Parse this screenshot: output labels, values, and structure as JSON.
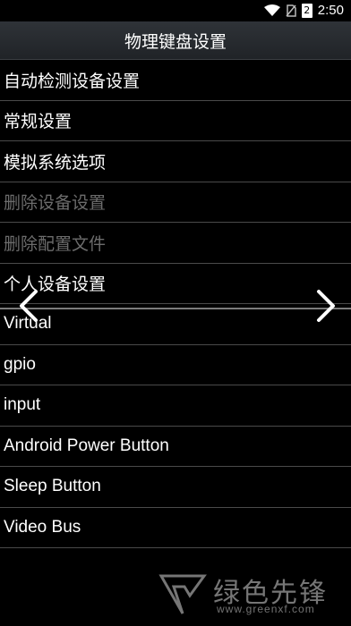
{
  "status": {
    "time": "2:50",
    "battery_level": "2"
  },
  "header": {
    "title": "物理键盘设置"
  },
  "menu": {
    "items": [
      {
        "label": "自动检测设备设置"
      },
      {
        "label": "常规设置"
      },
      {
        "label": "模拟系统选项"
      },
      {
        "label": "删除设备设置"
      },
      {
        "label": "删除配置文件"
      },
      {
        "label": "个人设备设置"
      },
      {
        "label": "Virtual"
      },
      {
        "label": "gpio"
      },
      {
        "label": "input"
      },
      {
        "label": "Android Power Button"
      },
      {
        "label": "Sleep Button"
      },
      {
        "label": "Video Bus"
      }
    ]
  },
  "watermark": {
    "brand": "绿色先锋",
    "url": "www.greenxf.com"
  }
}
